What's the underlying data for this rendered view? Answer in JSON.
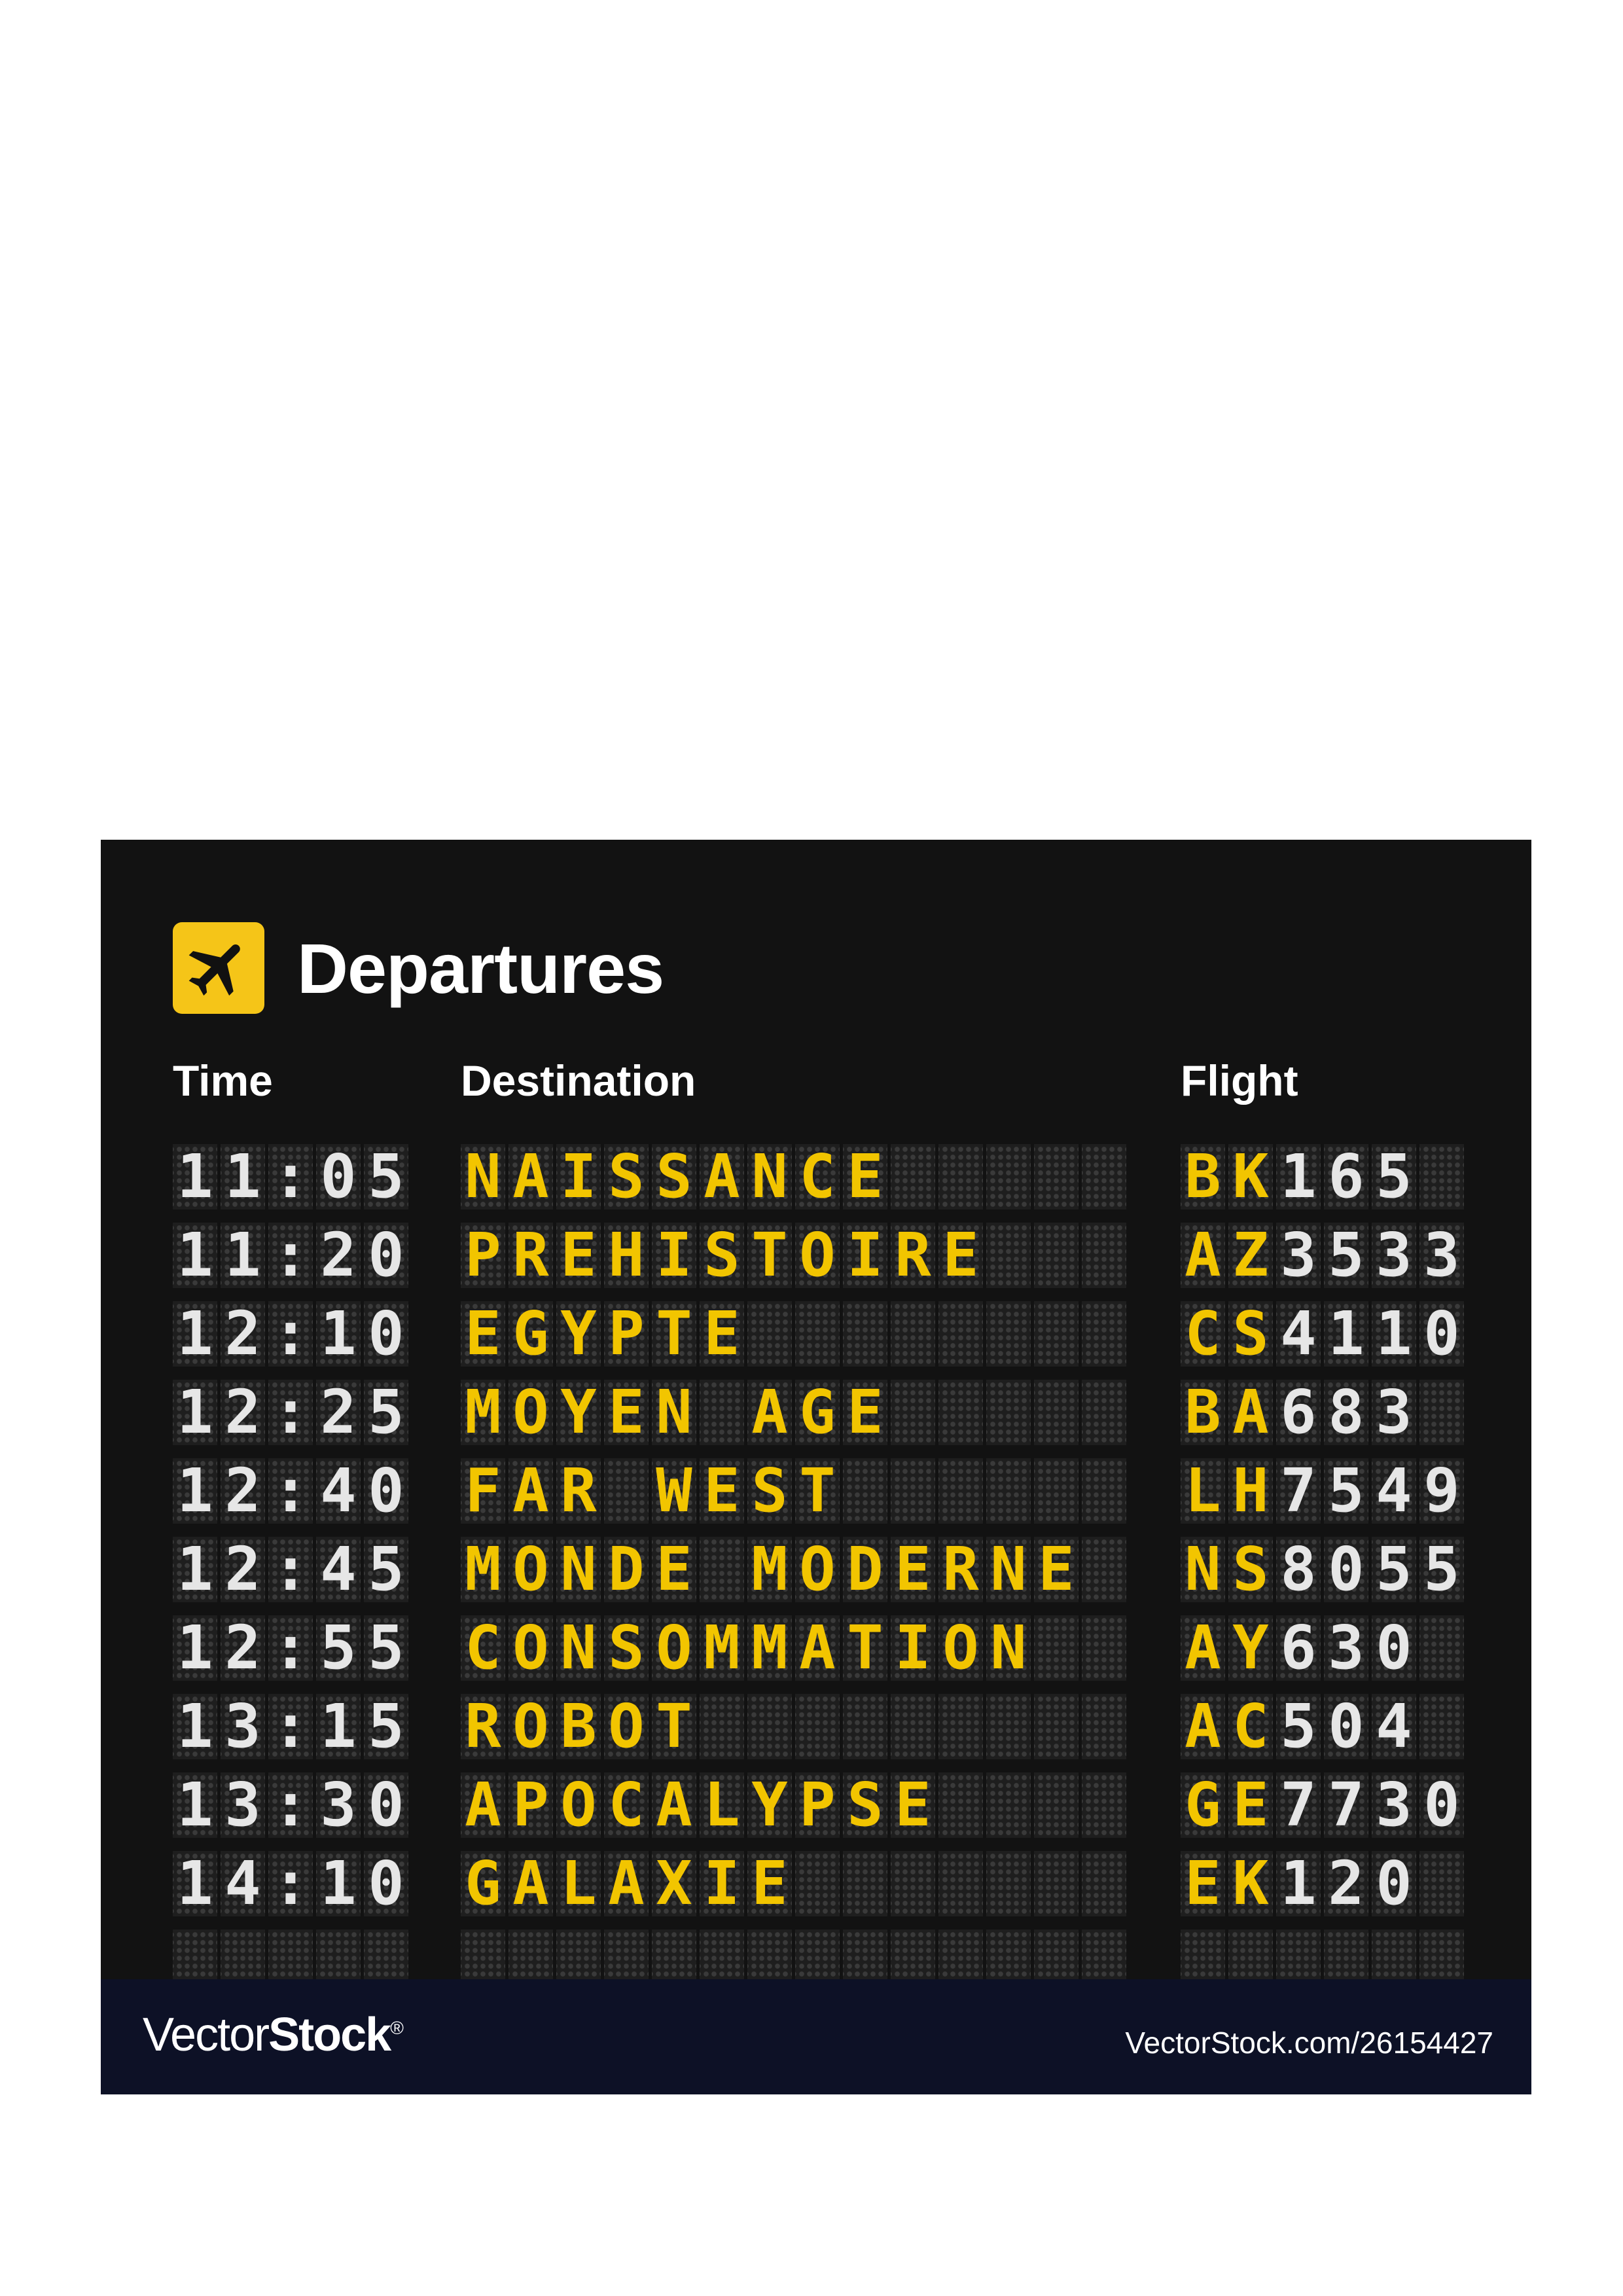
{
  "board": {
    "title": "Departures",
    "icon": "airplane-icon",
    "accent_color": "#f5c518",
    "digit_color": "#e6e6e6",
    "text_color": "#f2c500",
    "background_color": "#121212",
    "headers": {
      "time": "Time",
      "destination": "Destination",
      "flight": "Flight"
    },
    "rows": [
      {
        "time": "11:05",
        "destination": "NAISSANCE",
        "flight_code": "BK",
        "flight_number": "165"
      },
      {
        "time": "11:20",
        "destination": "PREHISTOIRE",
        "flight_code": "AZ",
        "flight_number": "3533"
      },
      {
        "time": "12:10",
        "destination": "EGYPTE",
        "flight_code": "CS",
        "flight_number": "4110"
      },
      {
        "time": "12:25",
        "destination": "MOYEN AGE",
        "flight_code": "BA",
        "flight_number": "683"
      },
      {
        "time": "12:40",
        "destination": "FAR WEST",
        "flight_code": "LH",
        "flight_number": "7549"
      },
      {
        "time": "12:45",
        "destination": "MONDE MODERNE",
        "flight_code": "NS",
        "flight_number": "8055"
      },
      {
        "time": "12:55",
        "destination": "CONSOMMATION",
        "flight_code": "AY",
        "flight_number": "630"
      },
      {
        "time": "13:15",
        "destination": "ROBOT",
        "flight_code": "AC",
        "flight_number": "504"
      },
      {
        "time": "13:30",
        "destination": "APOCALYPSE",
        "flight_code": "GE",
        "flight_number": "7730"
      },
      {
        "time": "14:10",
        "destination": "GALAXIE",
        "flight_code": "EK",
        "flight_number": "120"
      },
      {
        "time": "",
        "destination": "",
        "flight_code": "",
        "flight_number": ""
      }
    ]
  },
  "footer": {
    "brand_light": "Vector",
    "brand_bold": "Stock",
    "brand_mark": "®",
    "url": "VectorStock.com/26154427"
  }
}
